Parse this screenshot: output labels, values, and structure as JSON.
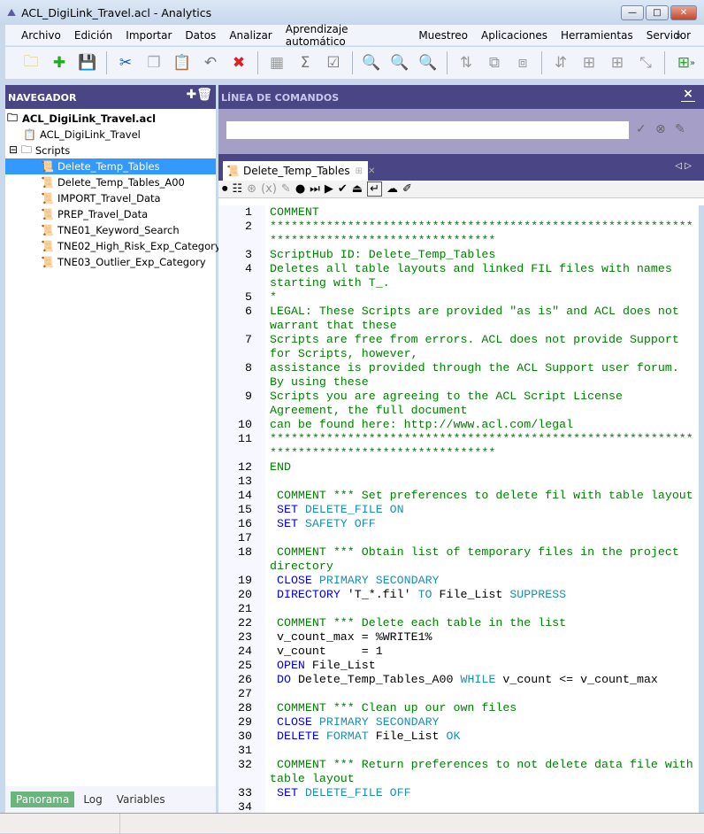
{
  "window": {
    "title": "ACL_DigiLink_Travel.acl - Analytics",
    "minimize": "—",
    "maximize": "□",
    "close": "✕"
  },
  "menu": [
    "Archivo",
    "Edición",
    "Importar",
    "Datos",
    "Analizar",
    "Aprendizaje automático",
    "Muestreo",
    "Aplicaciones",
    "Herramientas",
    "Servidor"
  ],
  "navigator": {
    "title": "NAVEGADOR",
    "project": "ACL_DigiLink_Travel.acl",
    "items": [
      {
        "label": "ACL_DigiLink_Travel",
        "indent": 1,
        "icon": "📋"
      },
      {
        "label": "Scripts",
        "indent": 0,
        "icon": "⊟ 🗀"
      },
      {
        "label": "Delete_Temp_Tables",
        "indent": 2,
        "icon": "📜",
        "selected": true
      },
      {
        "label": "Delete_Temp_Tables_A00",
        "indent": 2,
        "icon": "📜"
      },
      {
        "label": "IMPORT_Travel_Data",
        "indent": 2,
        "icon": "📜"
      },
      {
        "label": "PREP_Travel_Data",
        "indent": 2,
        "icon": "📜"
      },
      {
        "label": "TNE01_Keyword_Search",
        "indent": 2,
        "icon": "📜"
      },
      {
        "label": "TNE02_High_Risk_Exp_Category",
        "indent": 2,
        "icon": "📜"
      },
      {
        "label": "TNE03_Outlier_Exp_Category",
        "indent": 2,
        "icon": "📜"
      }
    ],
    "tabs": [
      "Panorama",
      "Log",
      "Variables"
    ]
  },
  "command_line": {
    "title": "LÍNEA DE COMANDOS",
    "value": "",
    "close": "×"
  },
  "editor": {
    "tab": "Delete_Temp_Tables",
    "lines": [
      [
        1,
        [
          [
            "COMMENT",
            "m"
          ]
        ]
      ],
      [
        2,
        [
          [
            "********************************************************************************************",
            "m"
          ]
        ]
      ],
      [
        3,
        [
          [
            "ScriptHub ID: Delete_Temp_Tables",
            "m"
          ]
        ]
      ],
      [
        4,
        [
          [
            "Deletes all table layouts and linked FIL files with names starting with T_.",
            "m"
          ]
        ]
      ],
      [
        5,
        [
          [
            "*",
            "m"
          ]
        ]
      ],
      [
        6,
        [
          [
            "LEGAL: These Scripts are provided \"as is\" and ACL does not warrant that these",
            "m"
          ]
        ]
      ],
      [
        7,
        [
          [
            "Scripts are free from errors. ACL does not provide Support for Scripts, however,",
            "m"
          ]
        ]
      ],
      [
        8,
        [
          [
            "assistance is provided through the ACL Support user forum. By using these",
            "m"
          ]
        ]
      ],
      [
        9,
        [
          [
            "Scripts you are agreeing to the ACL Script License Agreement, the full document",
            "m"
          ]
        ]
      ],
      [
        10,
        [
          [
            "can be found here: http://www.acl.com/legal",
            "m"
          ]
        ]
      ],
      [
        11,
        [
          [
            "********************************************************************************************",
            "m"
          ]
        ]
      ],
      [
        12,
        [
          [
            "END",
            "m"
          ]
        ]
      ],
      [
        13,
        []
      ],
      [
        14,
        [
          [
            " COMMENT *** Set preferences to delete fil with table layout",
            "m"
          ]
        ]
      ],
      [
        15,
        [
          [
            " SET ",
            "k"
          ],
          [
            "DELETE_FILE ON",
            "p"
          ]
        ]
      ],
      [
        16,
        [
          [
            " SET ",
            "k"
          ],
          [
            "SAFETY OFF",
            "p"
          ]
        ]
      ],
      [
        17,
        []
      ],
      [
        18,
        [
          [
            " COMMENT *** Obtain list of temporary files in the project directory",
            "m"
          ]
        ]
      ],
      [
        19,
        [
          [
            " CLOSE ",
            "k"
          ],
          [
            "PRIMARY SECONDARY",
            "p"
          ]
        ]
      ],
      [
        20,
        [
          [
            " DIRECTORY ",
            "k"
          ],
          [
            "'T_*.fil' ",
            "s"
          ],
          [
            "TO ",
            "p"
          ],
          [
            "File_List ",
            "s"
          ],
          [
            "SUPPRESS",
            "p"
          ]
        ]
      ],
      [
        21,
        []
      ],
      [
        22,
        [
          [
            " COMMENT *** Delete each table in the list",
            "m"
          ]
        ]
      ],
      [
        23,
        [
          [
            " v_count_max = %WRITE1%",
            "s"
          ]
        ]
      ],
      [
        24,
        [
          [
            " v_count     = 1",
            "s"
          ]
        ]
      ],
      [
        25,
        [
          [
            " OPEN ",
            "k"
          ],
          [
            "File_List",
            "s"
          ]
        ]
      ],
      [
        26,
        [
          [
            " DO ",
            "k"
          ],
          [
            "Delete_Temp_Tables_A00 ",
            "s"
          ],
          [
            "WHILE ",
            "p"
          ],
          [
            "v_count <= v_count_max",
            "s"
          ]
        ]
      ],
      [
        27,
        []
      ],
      [
        28,
        [
          [
            " COMMENT *** Clean up our own files",
            "m"
          ]
        ]
      ],
      [
        29,
        [
          [
            " CLOSE ",
            "k"
          ],
          [
            "PRIMARY SECONDARY",
            "p"
          ]
        ]
      ],
      [
        30,
        [
          [
            " DELETE ",
            "k"
          ],
          [
            "FORMAT ",
            "p"
          ],
          [
            "File_List ",
            "s"
          ],
          [
            "OK",
            "p"
          ]
        ]
      ],
      [
        31,
        []
      ],
      [
        32,
        [
          [
            " COMMENT *** Return preferences to not delete data file with table layout",
            "m"
          ]
        ]
      ],
      [
        33,
        [
          [
            " SET ",
            "k"
          ],
          [
            "DELETE_FILE OFF",
            "p"
          ]
        ]
      ],
      [
        34,
        []
      ]
    ]
  },
  "colors": {
    "header": "#4a4585",
    "selection": "#3399ff",
    "comment": "#008000",
    "keyword": "#0000ee",
    "param": "#1a8fb0"
  }
}
